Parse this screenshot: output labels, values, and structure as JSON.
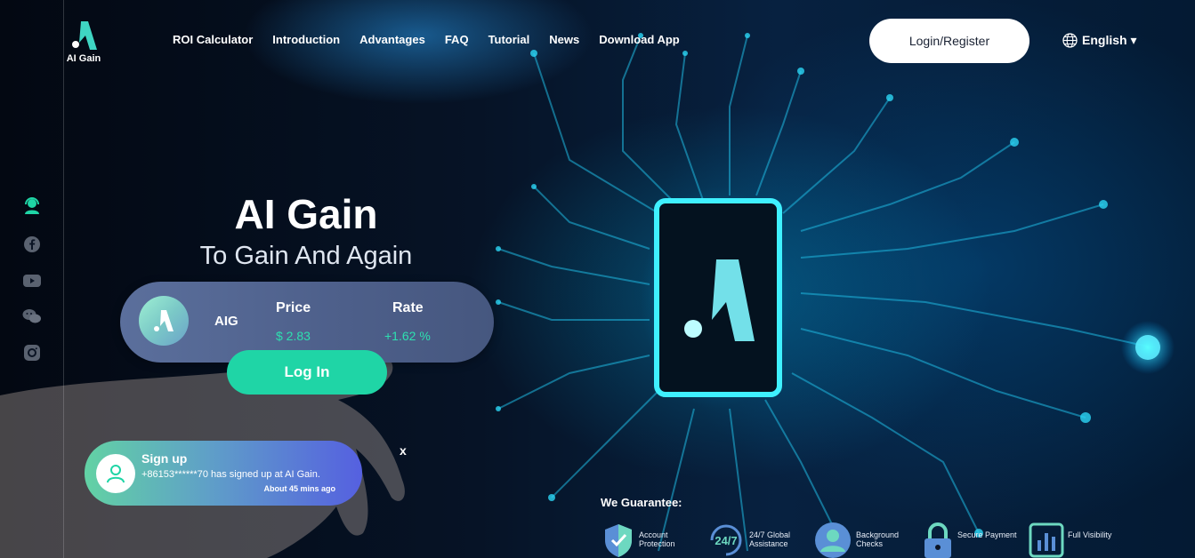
{
  "brand": {
    "name": "AI Gain"
  },
  "nav": {
    "items": [
      "ROI Calculator",
      "Introduction",
      "Advantages",
      "FAQ",
      "Tutorial",
      "News",
      "Download App"
    ]
  },
  "header": {
    "login_register": "Login/Register",
    "language": "English ▾"
  },
  "socials": [
    "support-agent-icon",
    "facebook-icon",
    "youtube-icon",
    "wechat-icon",
    "instagram-icon"
  ],
  "hero": {
    "title": "AI Gain",
    "subtitle": "To Gain And Again"
  },
  "ticker": {
    "symbol": "AIG",
    "price_label": "Price",
    "price_value": "$ 2.83",
    "rate_label": "Rate",
    "rate_value": "+1.62 %"
  },
  "login_button": "Log In",
  "toast": {
    "title": "Sign up",
    "message": "+86153******70 has signed up at AI Gain.",
    "time": "About 45 mins ago",
    "close": "x"
  },
  "guarantee": {
    "title": "We Guarantee:",
    "items": [
      {
        "line1": "Account",
        "line2": "Protection",
        "icon": "shield-icon"
      },
      {
        "line1": "24/7 Global",
        "line2": "Assistance",
        "icon": "clock-24-7-icon"
      },
      {
        "line1": "Background",
        "line2": "Checks",
        "icon": "user-check-icon"
      },
      {
        "line1": "Secure Payment",
        "line2": "",
        "icon": "lock-icon"
      },
      {
        "line1": "Full Visibility",
        "line2": "",
        "icon": "bar-chart-icon"
      }
    ]
  },
  "colors": {
    "accent": "#1fd5a6",
    "rate": "#2ee0b0",
    "background": "#050b1a"
  }
}
